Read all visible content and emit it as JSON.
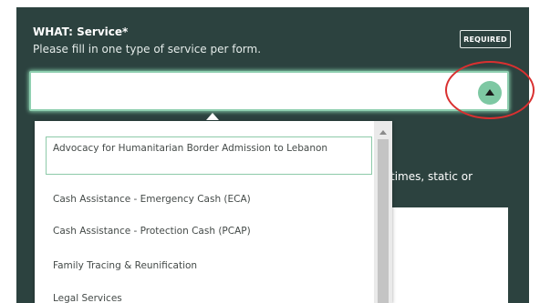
{
  "form": {
    "title": "WHAT: Service*",
    "subtitle": "Please fill in one type of service per form.",
    "required_badge": "REQUIRED"
  },
  "select": {
    "value": "",
    "toggle_icon": "caret-up-icon"
  },
  "dropdown": {
    "options": [
      "Advocacy for Humanitarian Border Admission to Lebanon",
      "Cash Assistance - Emergency Cash (ECA)",
      "Cash Assistance - Protection Cash (PCAP)",
      "Family Tracing & Reunification",
      "Legal Services"
    ],
    "selected_index": 0
  },
  "background": {
    "partial_text": "times, static or"
  },
  "colors": {
    "panel": "#2c423f",
    "accent": "#7ec8a3",
    "annotation": "#d93030"
  }
}
